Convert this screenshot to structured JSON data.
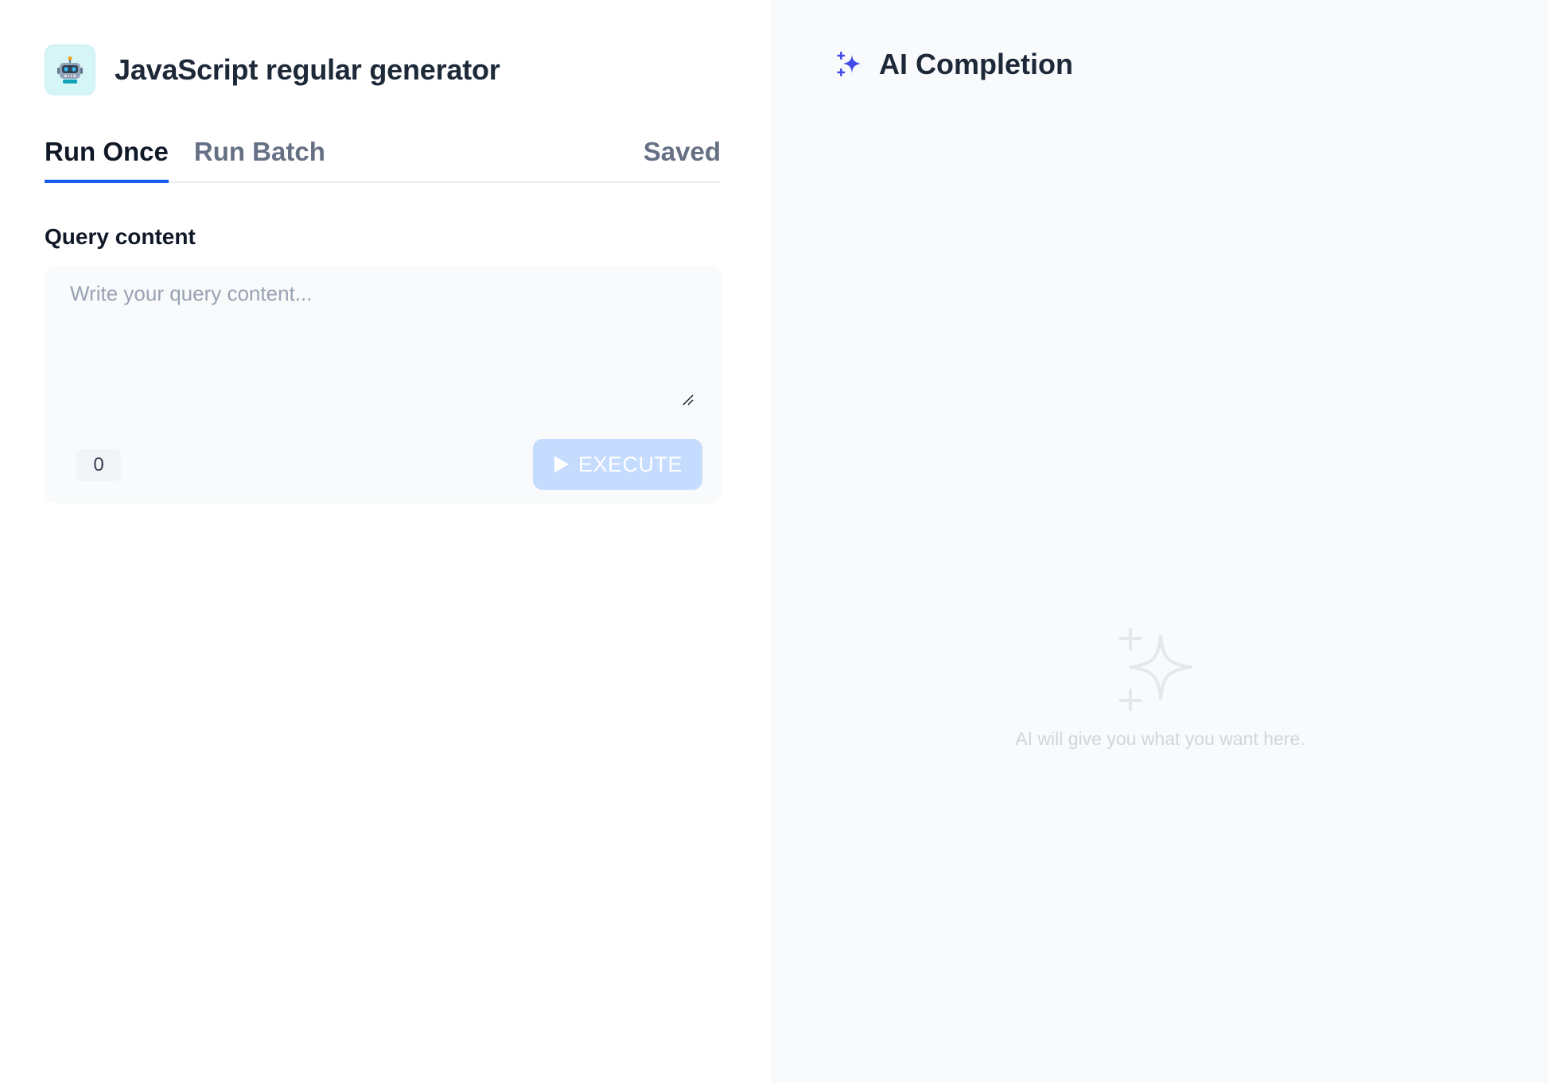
{
  "app": {
    "title": "JavaScript regular generator",
    "icon": "robot-icon",
    "icon_bg_color": "#d5f5f6"
  },
  "tabs": {
    "run_once": "Run Once",
    "run_batch": "Run Batch",
    "saved": "Saved",
    "active": "Run Once",
    "accent_color": "#155eef"
  },
  "query": {
    "label": "Query content",
    "placeholder": "Write your query content...",
    "value": "",
    "char_count": "0"
  },
  "execute": {
    "label": "EXECUTE",
    "icon": "play-icon",
    "disabled": true,
    "bg_color": "#c6dcfe"
  },
  "completion": {
    "title": "AI Completion",
    "icon": "sparkle-icon",
    "icon_color": "#444ce7",
    "empty_icon": "sparkle-empty-icon",
    "empty_text": "AI will give you what you want here."
  }
}
